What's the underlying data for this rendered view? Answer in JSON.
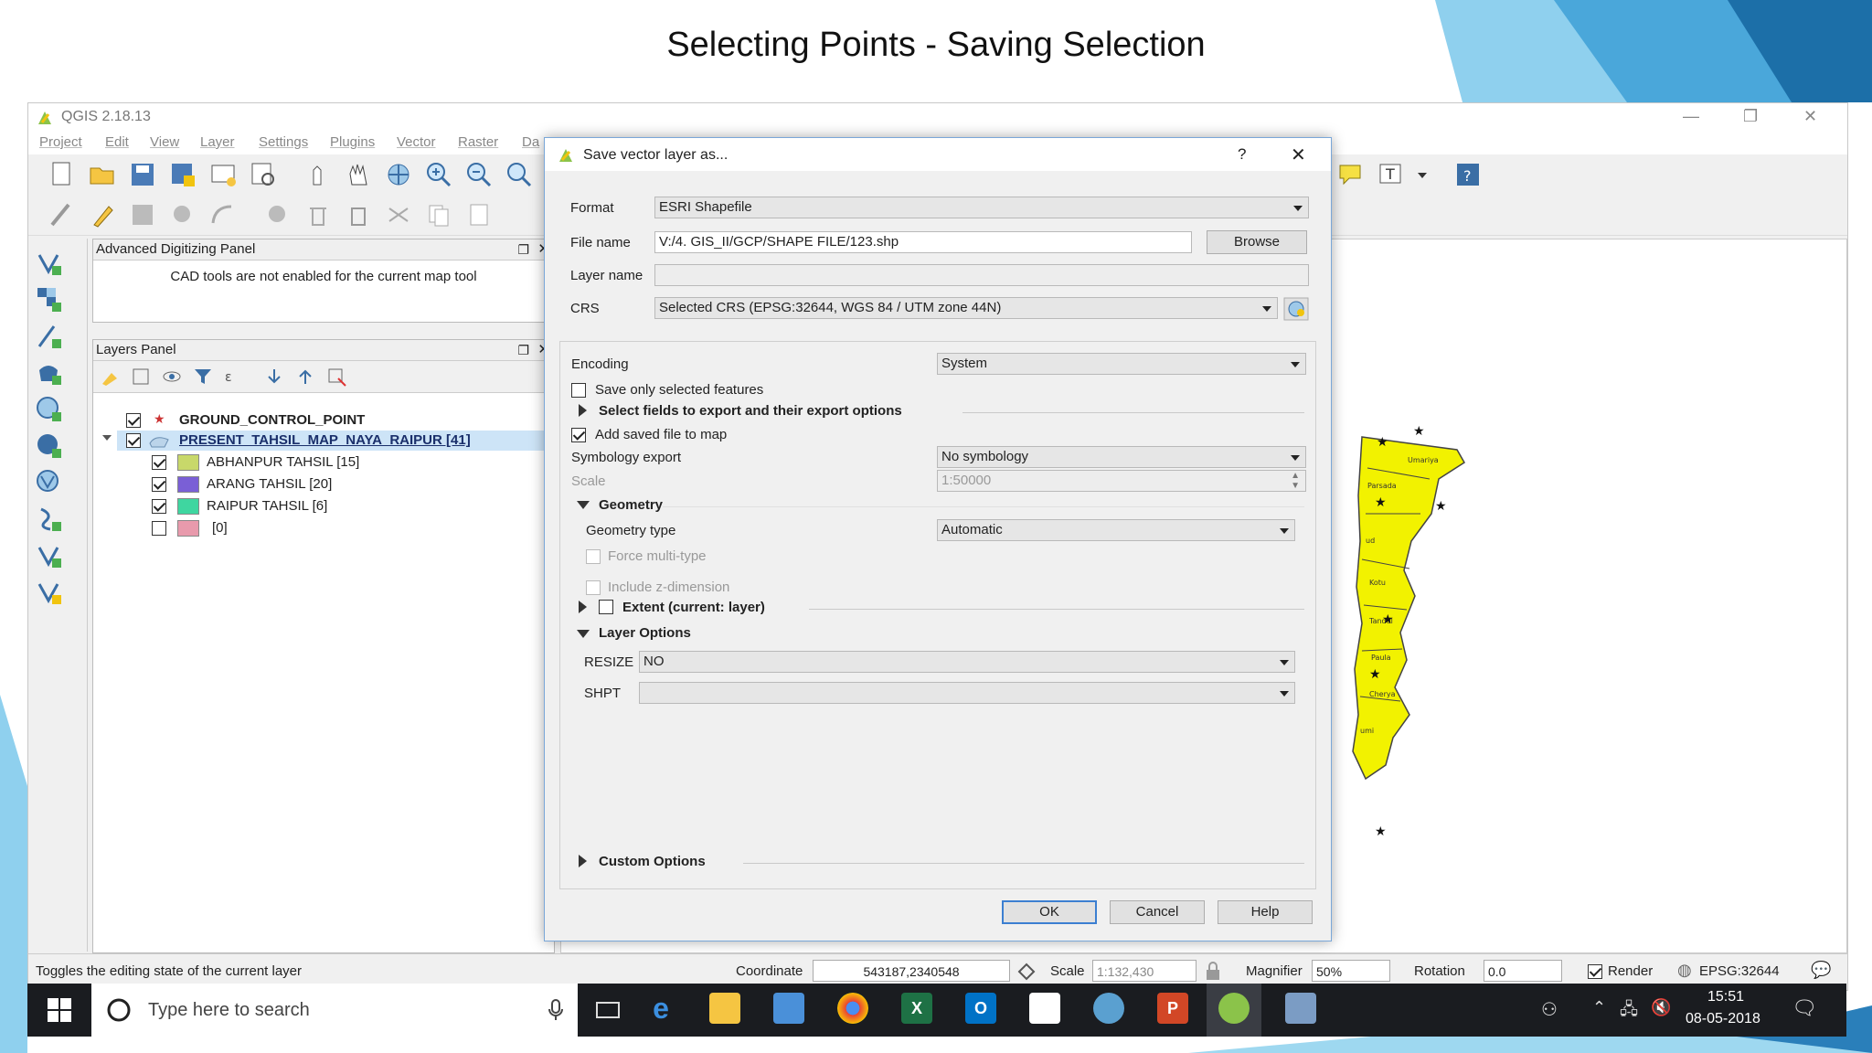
{
  "slide": {
    "title": "Selecting Points - Saving Selection"
  },
  "app": {
    "title": "QGIS 2.18.13",
    "menu": [
      "Project",
      "Edit",
      "View",
      "Layer",
      "Settings",
      "Plugins",
      "Vector",
      "Raster",
      "Da"
    ]
  },
  "digitizing_panel": {
    "title": "Advanced Digitizing Panel",
    "message": "CAD tools are not enabled for the current map tool"
  },
  "layers_panel": {
    "title": "Layers Panel",
    "layers": [
      {
        "label": "GROUND_CONTROL_POINT",
        "checked": true,
        "bold": true
      },
      {
        "label": "PRESENT_TAHSIL_MAP_NAYA_RAIPUR [41]",
        "checked": true,
        "bold": true,
        "selected": true
      }
    ],
    "sublayers": [
      {
        "label": "ABHANPUR TAHSIL [15]",
        "checked": true,
        "color": "#c8d86a"
      },
      {
        "label": "ARANG TAHSIL [20]",
        "checked": true,
        "color": "#7a5fd6"
      },
      {
        "label": "RAIPUR TAHSIL [6]",
        "checked": true,
        "color": "#3fd6a0"
      },
      {
        "label": "[0]",
        "checked": false,
        "color": "#e89aac"
      }
    ]
  },
  "dialog": {
    "title": "Save vector layer as...",
    "help_glyph": "?",
    "format_label": "Format",
    "format_value": "ESRI Shapefile",
    "filename_label": "File name",
    "filename_value": "V:/4. GIS_II/GCP/SHAPE FILE/123.shp",
    "browse": "Browse",
    "layername_label": "Layer name",
    "crs_label": "CRS",
    "crs_value": "Selected CRS (EPSG:32644, WGS 84 / UTM zone 44N)",
    "encoding_label": "Encoding",
    "encoding_value": "System",
    "save_selected_label": "Save only selected features",
    "select_fields_label": "Select fields to export and their export options",
    "add_saved_label": "Add saved file to map",
    "symbology_label": "Symbology export",
    "symbology_value": "No symbology",
    "scale_label": "Scale",
    "scale_value": "1:50000",
    "geometry_section": "Geometry",
    "geometry_type_label": "Geometry type",
    "geometry_type_value": "Automatic",
    "force_multi_label": "Force multi-type",
    "include_z_label": "Include z-dimension",
    "extent_label": "Extent (current: layer)",
    "layer_options_section": "Layer Options",
    "resize_label": "RESIZE",
    "resize_value": "NO",
    "shpt_label": "SHPT",
    "shpt_value": "",
    "custom_options_section": "Custom Options",
    "ok": "OK",
    "cancel": "Cancel",
    "help": "Help"
  },
  "map_labels": [
    "Umariya",
    "Parsada",
    "ud",
    "Kotu",
    "Tandul",
    "Paula",
    "Cherya",
    "umi"
  ],
  "statusbar": {
    "message": "Toggles the editing state of the current layer",
    "coordinate_label": "Coordinate",
    "coordinate_value": "543187,2340548",
    "scale_label": "Scale",
    "scale_value": "1:132,430",
    "magnifier_label": "Magnifier",
    "magnifier_value": "50%",
    "rotation_label": "Rotation",
    "rotation_value": "0.0",
    "render_label": "Render",
    "epsg": "EPSG:32644"
  },
  "taskbar": {
    "search_placeholder": "Type here to search",
    "time": "15:51",
    "date": "08-05-2018"
  },
  "colors": {
    "accent": "#3c7fd1",
    "map_yellow": "#f2f200",
    "slide_blue": "#56b4e0"
  }
}
